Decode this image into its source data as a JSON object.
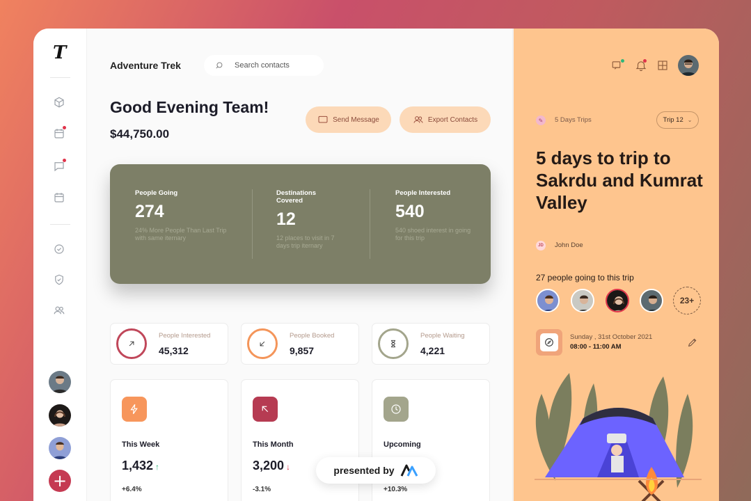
{
  "app": {
    "logo": "T",
    "brand": "Adventure Trek",
    "search_placeholder": "Search contacts",
    "greeting": "Good Evening Team!",
    "amount": "$44,750.00",
    "send_message": "Send Message",
    "export_contacts": "Export Contacts"
  },
  "stats": [
    {
      "label": "People Going",
      "value": "274",
      "sub": "24% More People Than Last Trip with same iternary"
    },
    {
      "label": "Destinations Covered",
      "value": "12",
      "sub": "12 places to visit in 7 days trip iternary"
    },
    {
      "label": "People Interested",
      "value": "540",
      "sub": "540 shoed interest in going for this trip"
    }
  ],
  "mini_cards": [
    {
      "label": "People Interested",
      "value": "45,312",
      "color": "#c0475a"
    },
    {
      "label": "People Booked",
      "value": "9,857",
      "color": "#f4955a"
    },
    {
      "label": "People Waiting",
      "value": "4,221",
      "color": "#a3a58c"
    }
  ],
  "big_cards": [
    {
      "label": "This Week",
      "value": "1,432",
      "arrow": "↑",
      "arrow_color": "#2fb67a",
      "pct": "+6.4%",
      "icon_bg": "#f7965c"
    },
    {
      "label": "This Month",
      "value": "3,200",
      "arrow": "↓",
      "arrow_color": "#e0344b",
      "pct": "-3.1%",
      "icon_bg": "#b63b52"
    },
    {
      "label": "Upcoming",
      "value": "",
      "arrow": "",
      "arrow_color": "#2fb67a",
      "pct": "+10.3%",
      "icon_bg": "#a3a58c"
    }
  ],
  "presented_by": "presented by",
  "trip": {
    "tag": "5 Days Trips",
    "select": "Trip 12",
    "title": "5 days to trip to Sakrdu and Kumrat Valley",
    "author_initials": "JD",
    "author": "John Doe",
    "going_text": "27 people going to this trip",
    "more": "23+",
    "date": "Sunday , 31st October 2021",
    "time": "08:00 - 11:00 AM"
  }
}
